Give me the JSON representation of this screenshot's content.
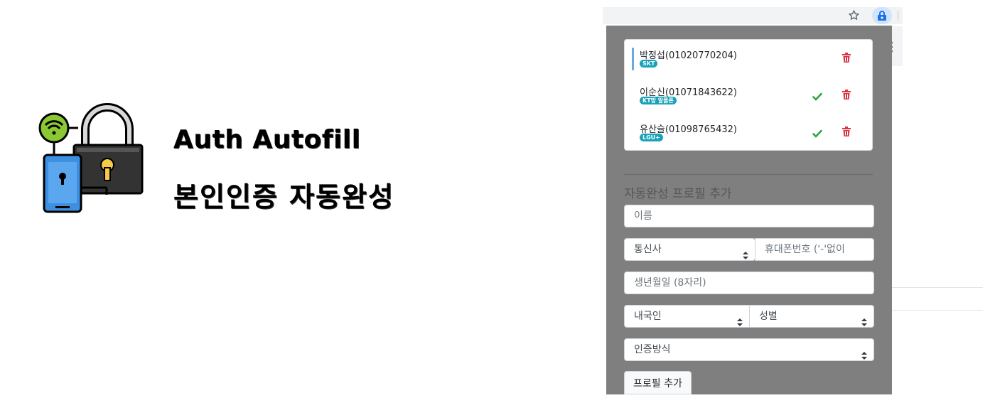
{
  "hero": {
    "title": "Auth Autofill",
    "subtitle": "본인인증 자동완성",
    "logo_icon": "lock-and-phone-wifi-icon"
  },
  "browser": {
    "bookmark_icon": "star-outline-icon",
    "extension_icon": "auth-autofill-extension-icon",
    "menu_icon": "kebab-menu-icon"
  },
  "popup": {
    "profiles": [
      {
        "name": "박정섭(01020770204)",
        "carrier": "SKT",
        "active": true,
        "show_select": false
      },
      {
        "name": "이순신(01071843622)",
        "carrier": "KT망 알뜰폰",
        "active": false,
        "show_select": true
      },
      {
        "name": "유산슬(01098765432)",
        "carrier": "LGU+",
        "active": false,
        "show_select": true
      }
    ],
    "add_section_title": "자동완성 프로필 추가",
    "form": {
      "name_placeholder": "이름",
      "carrier_select": "통신사",
      "phone_placeholder": "휴대폰번호 ('-'없이",
      "birth_placeholder": "생년월일 (8자리)",
      "nationality_select": "내국인",
      "gender_select": "성별",
      "auth_method_select": "인증방식",
      "submit_label": "프로필 추가"
    }
  },
  "colors": {
    "popup_bg": "#7f7f7f",
    "badge": "#17a2b8",
    "check": "#28a745",
    "trash": "#dc3545",
    "active_marker": "#6aa9e3"
  }
}
